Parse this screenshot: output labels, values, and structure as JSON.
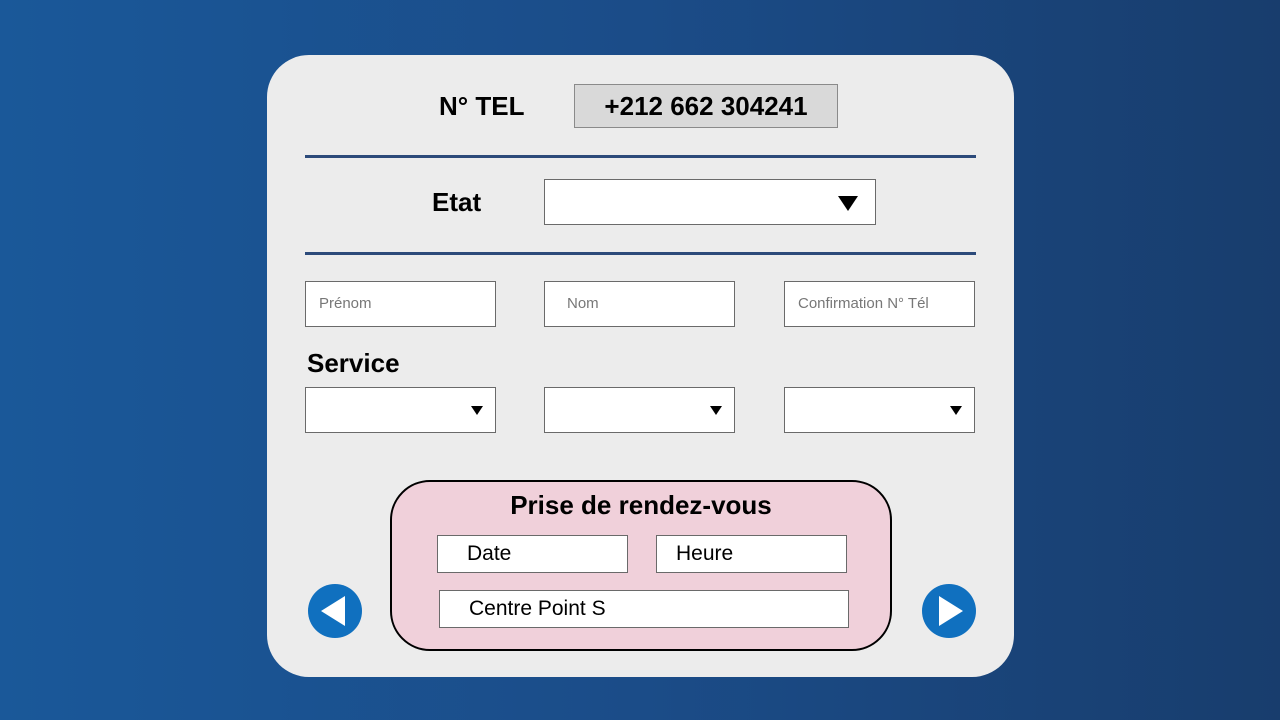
{
  "tel": {
    "label": "N° TEL",
    "value": "+212 662 304241"
  },
  "etat": {
    "label": "Etat",
    "value": "",
    "icon": "dropdown-arrow-icon"
  },
  "fields": {
    "prenom_placeholder": "Prénom",
    "nom_placeholder": "Nom",
    "confirmation_placeholder": "Confirmation N° Tél"
  },
  "service": {
    "label": "Service",
    "selects": [
      "",
      "",
      ""
    ]
  },
  "rdv": {
    "title": "Prise de rendez-vous",
    "date": "Date",
    "heure": "Heure",
    "centre": "Centre Point S",
    "background": "#f0d0da"
  },
  "nav": {
    "prev_icon": "arrow-left-icon",
    "next_icon": "arrow-right-icon",
    "color": "#1070bf"
  }
}
